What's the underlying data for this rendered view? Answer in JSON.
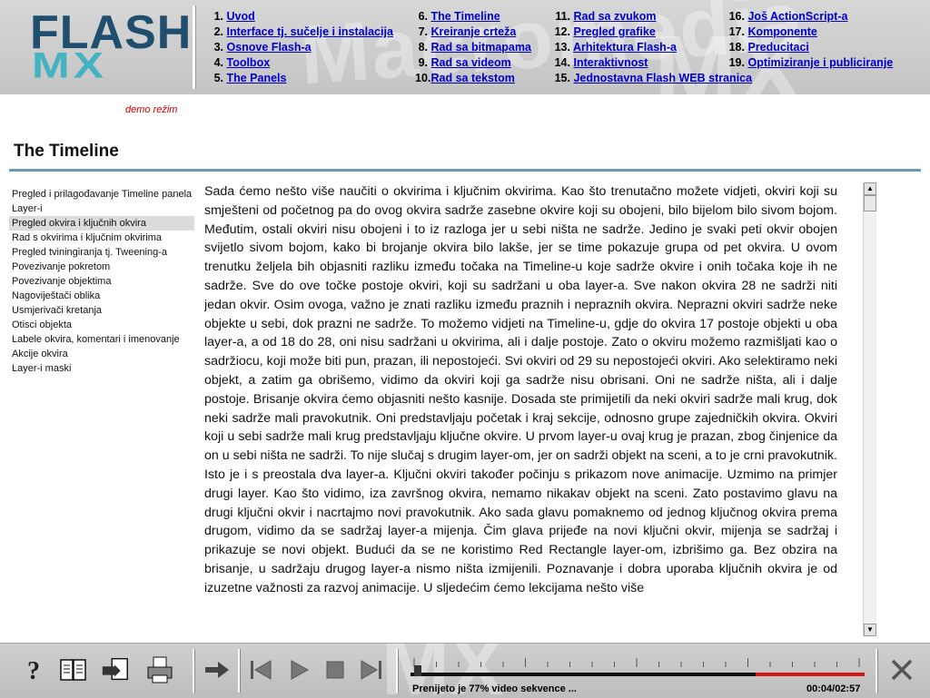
{
  "logo": {
    "flash": "FLASH",
    "mx": "MX"
  },
  "watermark": {
    "left": "Macromedia",
    "right": "MX"
  },
  "nav": {
    "columns": [
      [
        {
          "num": "1.",
          "label": "Uvod"
        },
        {
          "num": "2.",
          "label": "Interface tj. sučelje i instalacija"
        },
        {
          "num": "3.",
          "label": "Osnove Flash-a"
        },
        {
          "num": "4.",
          "label": "Toolbox"
        },
        {
          "num": "5.",
          "label": "The Panels"
        }
      ],
      [
        {
          "num": "6.",
          "label": "The Timeline"
        },
        {
          "num": "7.",
          "label": "Kreiranje crteža"
        },
        {
          "num": "8.",
          "label": "Rad sa bitmapama"
        },
        {
          "num": "9.",
          "label": "Rad sa videom"
        },
        {
          "num": "10.",
          "label": "Rad sa tekstom"
        }
      ],
      [
        {
          "num": "11.",
          "label": "Rad sa zvukom"
        },
        {
          "num": "12.",
          "label": "Pregled grafike"
        },
        {
          "num": "13.",
          "label": "Arhitektura Flash-a"
        },
        {
          "num": "14.",
          "label": "Interaktivnost"
        },
        {
          "num": "15.",
          "label": "Jednostavna Flash WEB stranica"
        }
      ],
      [
        {
          "num": "16.",
          "label": "Još ActionScript-a"
        },
        {
          "num": "17.",
          "label": "Komponente"
        },
        {
          "num": "18.",
          "label": "Preducitaci"
        },
        {
          "num": "19.",
          "label": "Optimiziranje i publiciranje"
        }
      ]
    ]
  },
  "demo_label": "demo režim",
  "page_title": "The Timeline",
  "topics": [
    "Pregled i prilagođavanje Timeline panela",
    "Layer-i",
    "Pregled okvira i ključnih okvira",
    "Rad s okvirima i ključnim okvirima",
    "Pregled tviningiranja tj. Tweening-a",
    "Povezivanje pokretom",
    "Povezivanje objektima",
    "Nagoviještači oblika",
    "Usmjerivači kretanja",
    "Otisci objekta",
    "Labele okvira, komentari i imenovanje",
    "Akcije okvira",
    "Layer-i maski"
  ],
  "active_topic_index": 2,
  "body_text": "Sada ćemo nešto više naučiti o okvirima i ključnim okvirima. Kao što trenutačno možete vidjeti, okviri koji su smješteni od početnog pa do ovog okvira sadrže zasebne okvire koji su obojeni, bilo bijelom bilo sivom bojom. Međutim, ostali okviri nisu obojeni i to iz razloga jer u sebi ništa ne sadrže. Jedino je svaki peti okvir obojen svijetlo sivom bojom, kako bi brojanje okvira bilo lakše, jer se time pokazuje grupa od pet okvira. U ovom trenutku željela bih objasniti razliku između točaka na Timeline-u koje sadrže okvire i onih točaka koje ih ne sadrže. Sve do ove točke postoje okviri, koji su sadržani u oba layer-a. Sve nakon okvira 28 ne sadrži niti jedan okvir. Osim ovoga, važno je znati razliku između praznih i nepraznih okvira. Neprazni okviri sadrže neke objekte u sebi, dok prazni ne sadrže. To možemo vidjeti na Timeline-u, gdje do okvira 17  postoje objekti u oba layer-a, a od 18 do 28, oni nisu sadržani u okvirima, ali i dalje postoje. Zato o okviru možemo razmišljati kao o sadržiocu, koji može biti pun, prazan, ili nepostojeći. Svi okviri od 29 su nepostojeći okviri. Ako selektiramo neki objekt, a zatim ga obrišemo, vidimo da okviri koji ga sadrže nisu obrisani. Oni ne sadrže ništa, ali i dalje postoje. Brisanje okvira ćemo objasniti nešto kasnije. Dosada ste primijetili da neki okviri sadrže mali krug, dok neki sadrže mali pravokutnik. Oni predstavljaju početak i kraj sekcije, odnosno grupe zajedničkih okvira. Okviri koji u sebi sadrže mali krug predstavljaju ključne okvire. U prvom layer-u ovaj krug je prazan, zbog činjenice da on u sebi ništa ne sadrži. To nije slučaj s drugim layer-om, jer on sadrži objekt na sceni, a to je crni pravokutnik. Isto je i s preostala dva layer-a. Ključni okviri također počinju s prikazom nove animacije. Uzmimo na primjer drugi layer. Kao što vidimo, iza završnog okvira, nemamo nikakav objekt na sceni. Zato postavimo glavu na drugi ključni okvir i nacrtajmo novi pravokutnik. Ako sada glavu pomaknemo od jednog ključnog okvira prema drugom, vidimo da se sadržaj layer-a mijenja. Čim glava prijeđe na novi ključni okvir, mijenja se sadržaj i prikazuje se novi objekt. Budući da se ne koristimo Red Rectangle layer-om, izbrišimo ga. Bez obzira na brisanje, u sadržaju drugog layer-a nismo ništa izmijenili. Poznavanje i dobra uporaba ključnih okvira je od izuzetne važnosti za razvoj animacije. U sljedećim ćemo lekcijama nešto više",
  "toolbar": {
    "icons": [
      "help-icon",
      "book-icon",
      "export-icon",
      "print-icon",
      "next-icon",
      "first-icon",
      "play-icon",
      "stop-icon",
      "last-icon",
      "close-icon"
    ]
  },
  "player": {
    "status": "Prenijeto je 77% video sekvence ...",
    "time": "00:04/02:57",
    "progress_fraction": 0.0,
    "loaded_fraction": 0.77
  },
  "colors": {
    "accent_rule": "#6d97b8",
    "link": "#0000cc",
    "demo": "#cc0000",
    "logo_dark": "#1f4e6e",
    "logo_teal": "#45b3bf",
    "loaded_bar": "#d01515"
  }
}
